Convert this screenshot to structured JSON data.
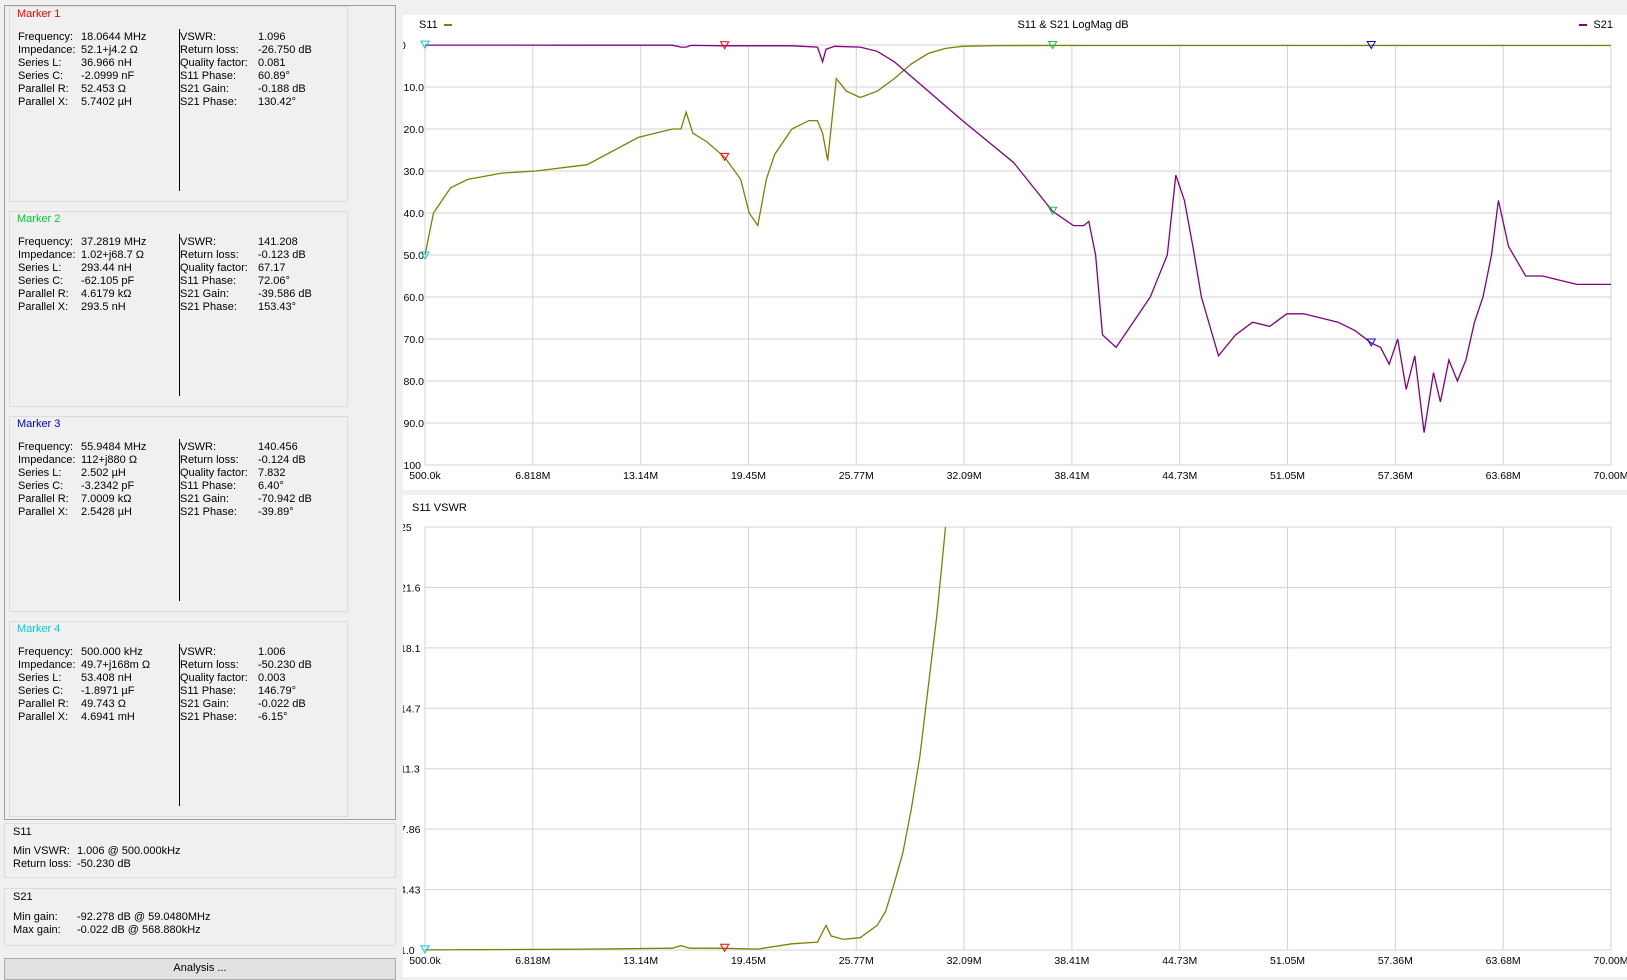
{
  "markers": [
    {
      "title": "Marker 1",
      "color": "#ff0000",
      "left": [
        {
          "label": "Frequency:",
          "value": "18.0644 MHz"
        },
        {
          "label": "Impedance:",
          "value": "52.1+j4.2 Ω"
        },
        {
          "label": "Series L:",
          "value": "36.966 nH"
        },
        {
          "label": "Series C:",
          "value": "-2.0999 nF"
        },
        {
          "label": "Parallel R:",
          "value": "52.453 Ω"
        },
        {
          "label": "Parallel X:",
          "value": "5.7402 µH"
        }
      ],
      "right": [
        {
          "label": "VSWR:",
          "value": "1.096"
        },
        {
          "label": "Return loss:",
          "value": "-26.750 dB"
        },
        {
          "label": "Quality factor:",
          "value": "0.081"
        },
        {
          "label": "S11 Phase:",
          "value": "60.89°"
        },
        {
          "label": "S21 Gain:",
          "value": "-0.188 dB"
        },
        {
          "label": "S21 Phase:",
          "value": "130.42°"
        }
      ]
    },
    {
      "title": "Marker 2",
      "color": "#00cc33",
      "left": [
        {
          "label": "Frequency:",
          "value": "37.2819 MHz"
        },
        {
          "label": "Impedance:",
          "value": "1.02+j68.7 Ω"
        },
        {
          "label": "Series L:",
          "value": "293.44 nH"
        },
        {
          "label": "Series C:",
          "value": "-62.105 pF"
        },
        {
          "label": "Parallel R:",
          "value": "4.6179 kΩ"
        },
        {
          "label": "Parallel X:",
          "value": "293.5 nH"
        }
      ],
      "right": [
        {
          "label": "VSWR:",
          "value": "141.208"
        },
        {
          "label": "Return loss:",
          "value": "-0.123 dB"
        },
        {
          "label": "Quality factor:",
          "value": "67.17"
        },
        {
          "label": "S11 Phase:",
          "value": "72.06°"
        },
        {
          "label": "S21 Gain:",
          "value": "-39.586 dB"
        },
        {
          "label": "S21 Phase:",
          "value": "153.43°"
        }
      ]
    },
    {
      "title": "Marker 3",
      "color": "#0000cc",
      "left": [
        {
          "label": "Frequency:",
          "value": "55.9484 MHz"
        },
        {
          "label": "Impedance:",
          "value": "112+j880 Ω"
        },
        {
          "label": "Series L:",
          "value": "2.502 µH"
        },
        {
          "label": "Series C:",
          "value": "-3.2342 pF"
        },
        {
          "label": "Parallel R:",
          "value": "7.0009 kΩ"
        },
        {
          "label": "Parallel X:",
          "value": "2.5428 µH"
        }
      ],
      "right": [
        {
          "label": "VSWR:",
          "value": "140.456"
        },
        {
          "label": "Return loss:",
          "value": "-0.124 dB"
        },
        {
          "label": "Quality factor:",
          "value": "7.832"
        },
        {
          "label": "S11 Phase:",
          "value": "6.40°"
        },
        {
          "label": "S21 Gain:",
          "value": "-70.942 dB"
        },
        {
          "label": "S21 Phase:",
          "value": "-39.89°"
        }
      ]
    },
    {
      "title": "Marker 4",
      "color": "#00ccdd",
      "left": [
        {
          "label": "Frequency:",
          "value": "500.000 kHz"
        },
        {
          "label": "Impedance:",
          "value": "49.7+j168m Ω"
        },
        {
          "label": "Series L:",
          "value": "53.408 nH"
        },
        {
          "label": "Series C:",
          "value": "-1.8971 µF"
        },
        {
          "label": "Parallel R:",
          "value": "49.743 Ω"
        },
        {
          "label": "Parallel X:",
          "value": "4.6941 mH"
        }
      ],
      "right": [
        {
          "label": "VSWR:",
          "value": "1.006"
        },
        {
          "label": "Return loss:",
          "value": "-50.230 dB"
        },
        {
          "label": "Quality factor:",
          "value": "0.003"
        },
        {
          "label": "S11 Phase:",
          "value": "146.79°"
        },
        {
          "label": "S21 Gain:",
          "value": "-0.022 dB"
        },
        {
          "label": "S21 Phase:",
          "value": "-6.15°"
        }
      ]
    }
  ],
  "s11_summary": {
    "title": "S11",
    "min_vswr_label": "Min VSWR:",
    "min_vswr_value": "1.006 @ 500.000kHz",
    "return_loss_label": "Return loss:",
    "return_loss_value": "-50.230 dB"
  },
  "s21_summary": {
    "title": "S21",
    "min_gain_label": "Min gain:",
    "min_gain_value": "-92.278 dB @ 59.0480MHz",
    "max_gain_label": "Max gain:",
    "max_gain_value": "-0.022 dB @ 568.880kHz"
  },
  "analysis_button_label": "Analysis ...",
  "colors": {
    "s11": "#808000",
    "s21": "#800080",
    "marker1": "#ff0000",
    "marker2": "#00cc33",
    "marker3": "#0000cc",
    "marker4": "#00ccdd",
    "grid": "#d3d3d3"
  },
  "chart_data": [
    {
      "type": "line",
      "title": "S11 & S21 LogMag dB",
      "legend": [
        "S11",
        "S21"
      ],
      "x_tick_labels": [
        "500.0k",
        "6.818M",
        "13.14M",
        "19.45M",
        "25.77M",
        "32.09M",
        "38.41M",
        "44.73M",
        "51.05M",
        "57.36M",
        "63.68M",
        "70.00M"
      ],
      "y_tick_labels": [
        "0",
        "-10.0",
        "-20.0",
        "-30.0",
        "-40.0",
        "-50.0",
        "-60.0",
        "-70.0",
        "-80.0",
        "-90.0",
        "-100"
      ],
      "xlim": [
        0.5,
        70.0
      ],
      "ylim": [
        -100,
        0
      ],
      "series": [
        {
          "name": "S11",
          "x": [
            0.5,
            1,
            2,
            3,
            5,
            7,
            10,
            13,
            15,
            15.5,
            15.8,
            16.2,
            17,
            18.06,
            19,
            19.5,
            20,
            20.5,
            21,
            22,
            23,
            23.5,
            23.8,
            24.1,
            24.6,
            25.2,
            26,
            27,
            28,
            29,
            30,
            31,
            32,
            34,
            37.28,
            40,
            45,
            50,
            55.95,
            60,
            64,
            70
          ],
          "y": [
            -50,
            -40,
            -34,
            -32,
            -30.5,
            -30,
            -28.5,
            -22,
            -20,
            -20,
            -16,
            -21,
            -23,
            -26.75,
            -32,
            -40,
            -43,
            -32,
            -26,
            -20,
            -18,
            -18,
            -21,
            -27.5,
            -8,
            -11,
            -12.5,
            -11,
            -8,
            -4.5,
            -2,
            -0.8,
            -0.3,
            -0.15,
            -0.123,
            -0.13,
            -0.13,
            -0.13,
            -0.124,
            -0.12,
            -0.12,
            -0.12
          ]
        },
        {
          "name": "S21",
          "x": [
            0.5,
            5,
            10,
            15,
            15.5,
            15.8,
            16.1,
            18.06,
            22,
            23.5,
            23.8,
            24,
            24.5,
            26,
            27,
            28,
            30,
            32,
            35,
            37.28,
            38.5,
            39.1,
            39.4,
            39.8,
            40.2,
            41,
            42,
            43,
            44,
            44.5,
            45,
            45.5,
            46,
            47,
            48,
            49,
            50,
            51,
            52,
            53,
            54,
            55,
            55.95,
            56.5,
            57,
            57.5,
            58,
            58.5,
            59.05,
            59.6,
            60,
            60.5,
            61,
            61.5,
            62,
            62.5,
            63,
            63.4,
            64,
            65,
            66,
            67,
            68,
            69,
            70
          ],
          "y": [
            -0.022,
            -0.03,
            -0.05,
            -0.05,
            -0.5,
            -0.5,
            -0.1,
            -0.188,
            -0.2,
            -0.5,
            -4,
            -1,
            -0.3,
            -0.5,
            -1.5,
            -4,
            -11,
            -18,
            -28,
            -39.586,
            -43,
            -43,
            -42,
            -50,
            -69,
            -72,
            -66,
            -60,
            -50,
            -31,
            -37,
            -48,
            -60,
            -74,
            -69,
            -66,
            -67,
            -64,
            -64,
            -65,
            -66,
            -68,
            -70.942,
            -72,
            -76,
            -70,
            -82,
            -74,
            -92.278,
            -78,
            -85,
            -75,
            -80,
            -75,
            -66,
            -60,
            -50,
            -37,
            -48,
            -55,
            -55,
            -56,
            -57,
            -57,
            -57
          ]
        }
      ]
    },
    {
      "type": "line",
      "title": "S11 VSWR",
      "x_tick_labels": [
        "500.0k",
        "6.818M",
        "13.14M",
        "19.45M",
        "25.77M",
        "32.09M",
        "38.41M",
        "44.73M",
        "51.05M",
        "57.36M",
        "63.68M",
        "70.00M"
      ],
      "y_tick_labels": [
        "25",
        "21.6",
        "18.1",
        "14.7",
        "11.3",
        "7.86",
        "4.43",
        "1.0"
      ],
      "xlim": [
        0.5,
        70.0
      ],
      "ylim": [
        1.0,
        25
      ],
      "series": [
        {
          "name": "S11",
          "x": [
            0.5,
            10,
            15,
            15.5,
            16,
            17,
            18.06,
            20,
            22,
            23.5,
            24,
            24.3,
            25,
            26,
            27,
            27.5,
            28,
            28.5,
            29,
            29.5,
            30,
            30.5,
            30.8,
            31
          ],
          "y": [
            1.006,
            1.05,
            1.1,
            1.25,
            1.1,
            1.1,
            1.096,
            1.05,
            1.35,
            1.45,
            2.4,
            1.8,
            1.6,
            1.7,
            2.4,
            3.2,
            4.8,
            6.5,
            9,
            12,
            16,
            20,
            23,
            25
          ]
        }
      ]
    }
  ]
}
